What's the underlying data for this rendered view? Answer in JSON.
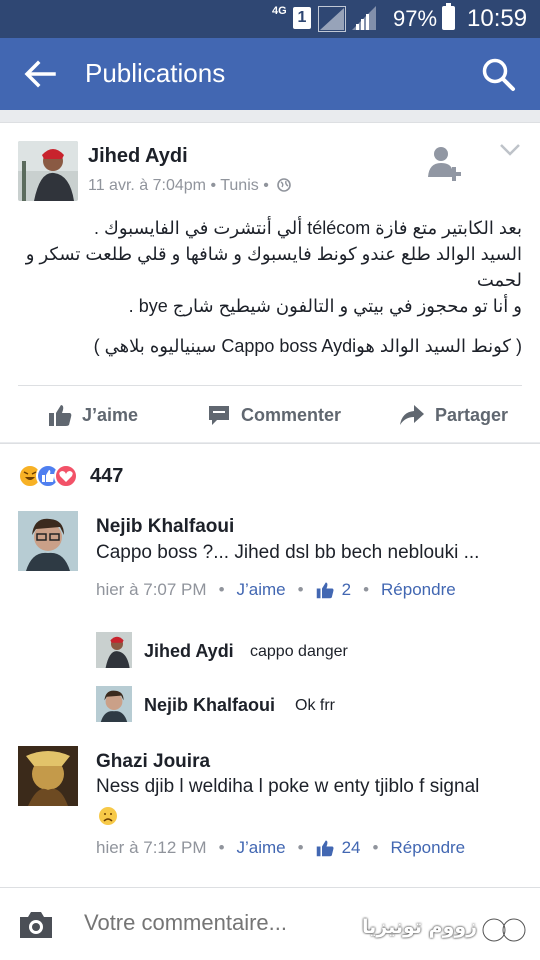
{
  "status_bar": {
    "network": "4G",
    "sim": "1",
    "battery": "97%",
    "time": "10:59"
  },
  "app_bar": {
    "title": "Publications"
  },
  "post": {
    "author": "Jihed Aydi",
    "date": "11 avr. à 7:04pm",
    "location": "Tunis",
    "lines": [
      "بعد الكابتير متع فازة télécom ألي أنتشرت في الفايسبوك .",
      "السيد الوالد طلع عندو كونط فايسبوك و شافها و قلي طلعت تسكر و لحمت",
      "و أنا تو محجوز في بيتي و التالفون شيطيح شارج bye .",
      "( كونط السيد الوالد هوCappo boss Aydi سينياليوه بلاهي )"
    ],
    "actions": {
      "like": "J’aime",
      "comment": "Commenter",
      "share": "Partager"
    }
  },
  "reactions": {
    "count": "447"
  },
  "comments": [
    {
      "author": "Nejib Khalfaoui",
      "text": "Cappo boss ?... Jihed dsl bb bech neblouki ...",
      "time": "hier à 7:07 PM",
      "like_label": "J’aime",
      "likes": "2",
      "reply_label": "Répondre",
      "replies": [
        {
          "author": "Jihed Aydi",
          "text": "cappo danger"
        },
        {
          "author": "Nejib Khalfaoui",
          "text": "Ok frr"
        }
      ]
    },
    {
      "author": "Ghazi Jouira",
      "text": "Ness djib l weldiha l poke w enty tjiblo f signal",
      "time": "hier à 7:12 PM",
      "like_label": "J’aime",
      "likes": "24",
      "reply_label": "Répondre"
    }
  ],
  "composer": {
    "placeholder": "Votre commentaire..."
  },
  "watermark": "زووم تونيزيا",
  "colors": {
    "brand": "#4267b2",
    "status_bar": "#2f4773",
    "meta_gray": "#90949c",
    "link_blue": "#4267b2"
  }
}
